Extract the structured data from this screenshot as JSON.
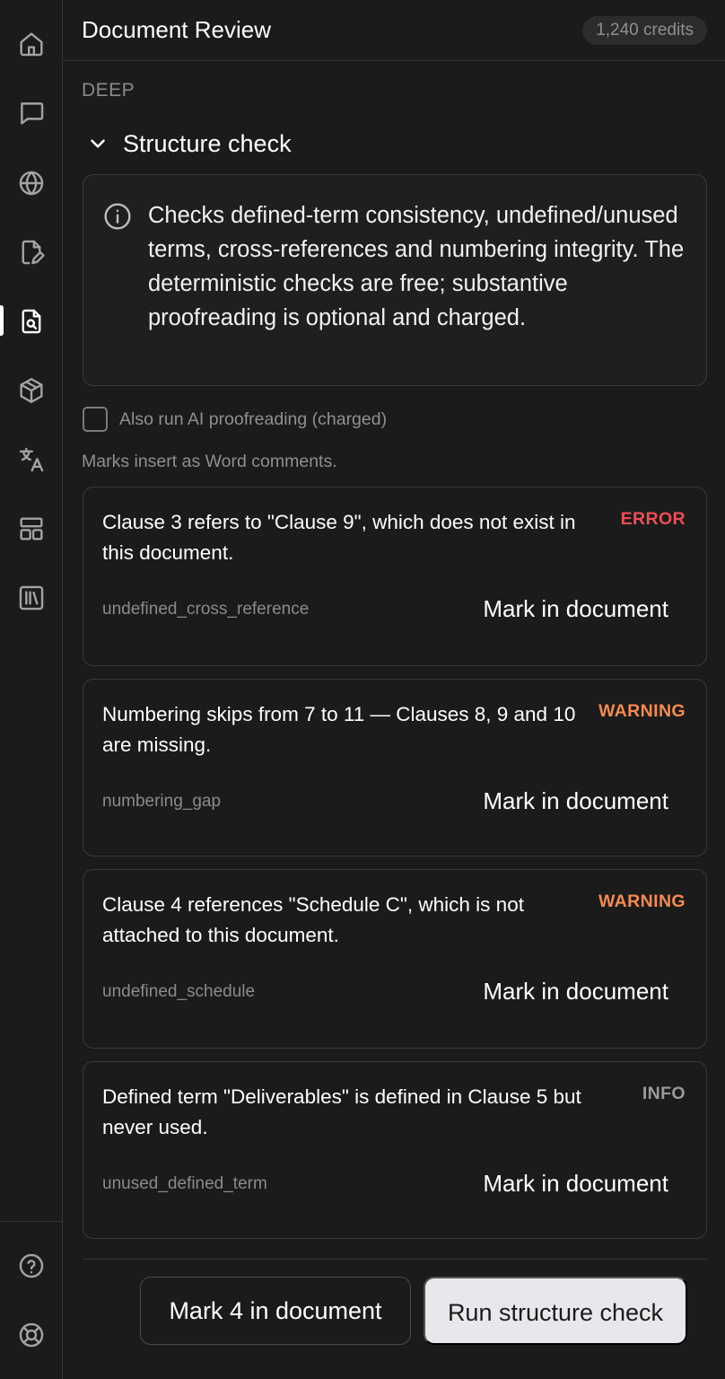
{
  "header": {
    "title": "Document Review",
    "credits": "1,240 credits"
  },
  "sidebar": {
    "items": [
      {
        "icon": "home-icon"
      },
      {
        "icon": "chat-icon"
      },
      {
        "icon": "globe-icon"
      },
      {
        "icon": "document-edit-icon"
      },
      {
        "icon": "document-search-icon",
        "active": true
      },
      {
        "icon": "cube-icon"
      },
      {
        "icon": "translate-icon"
      },
      {
        "icon": "layout-icon"
      },
      {
        "icon": "library-icon"
      }
    ],
    "bottom_items": [
      {
        "icon": "help-icon"
      },
      {
        "icon": "support-icon"
      }
    ]
  },
  "section": {
    "label": "DEEP",
    "title": "Structure check",
    "info": "Checks defined-term consistency, undefined/unused terms, cross-references and numbering integrity. The deterministic checks are free; substantive proofreading is optional and charged.",
    "checkbox_label": "Also run AI proofreading (charged)",
    "checkbox_checked": false,
    "note": "Marks insert as Word comments."
  },
  "findings": [
    {
      "message": "Clause 3 refers to \"Clause 9\", which does not exist in this document.",
      "severity": "ERROR",
      "code": "undefined_cross_reference",
      "action": "Mark in document"
    },
    {
      "message": "Numbering skips from 7 to 11 — Clauses 8, 9 and 10 are missing.",
      "severity": "WARNING",
      "code": "numbering_gap",
      "action": "Mark in document"
    },
    {
      "message": "Clause 4 references \"Schedule C\", which is not attached to this document.",
      "severity": "WARNING",
      "code": "undefined_schedule",
      "action": "Mark in document"
    },
    {
      "message": "Defined term \"Deliverables\" is defined in Clause 5 but never used.",
      "severity": "INFO",
      "code": "unused_defined_term",
      "action": "Mark in document"
    }
  ],
  "footer": {
    "mark_all_label": "Mark 4 in document",
    "run_label": "Run structure check"
  },
  "colors": {
    "error": "#ee4e55",
    "warning": "#f48a4e",
    "info": "#9a9a9a",
    "background": "#1b1b1b"
  }
}
